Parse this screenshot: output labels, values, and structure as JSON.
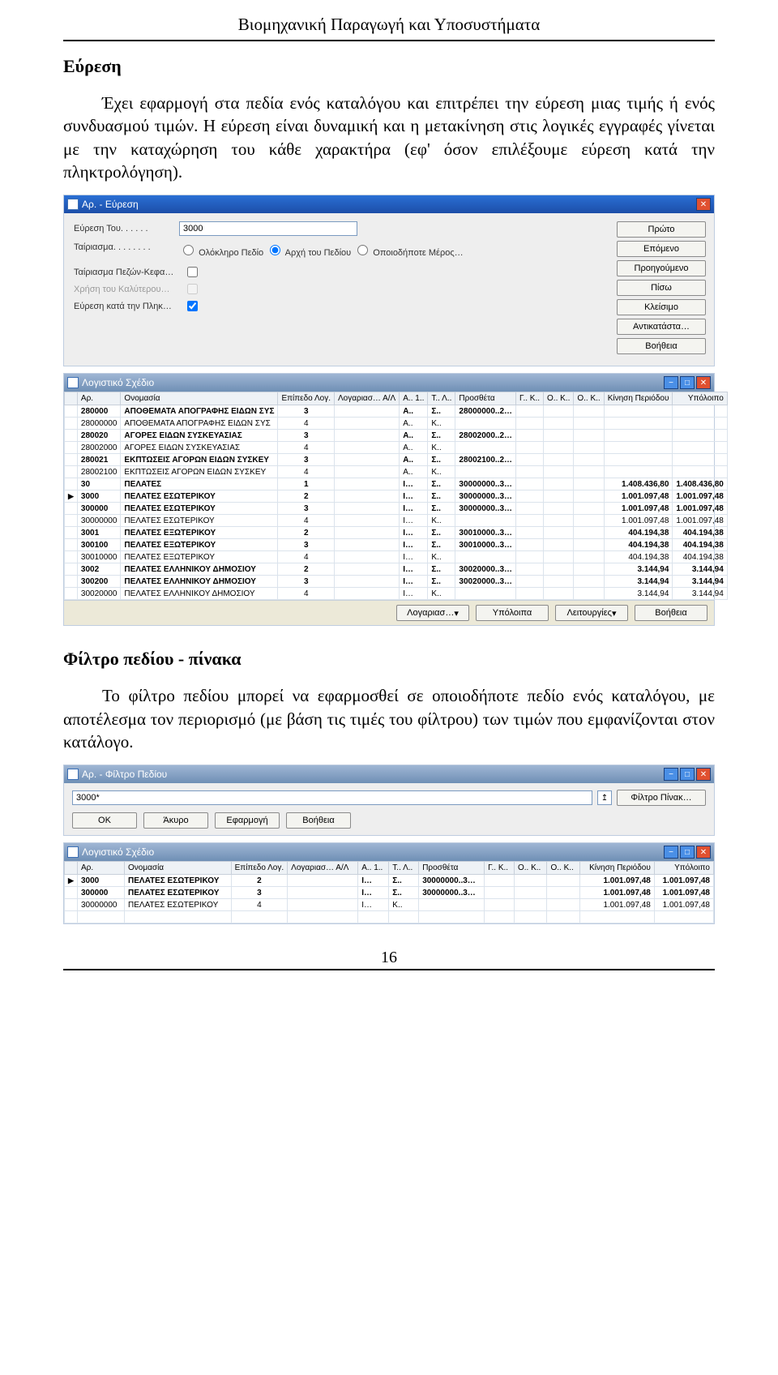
{
  "doc": {
    "running_head": "Βιομηχανική Παραγωγή και Υποσυστήματα",
    "section1_heading": "Εύρεση",
    "para1_line": "Έχει εφαρμογή στα πεδία ενός καταλόγου και επιτρέπει την εύρεση μιας τιμής ή ενός συνδυασμού τιμών. Η εύρεση είναι δυναμική και η μετακίνηση στις λογικές εγγραφές γίνεται με την καταχώρηση του κάθε χαρακτήρα (εφ' όσον επιλέξουμε εύρεση κατά την πληκτρολόγηση).",
    "section2_heading": "Φίλτρο πεδίου - πίνακα",
    "para2_line": "Το φίλτρο πεδίου μπορεί να εφαρμοσθεί σε οποιοδήποτε πεδίο ενός καταλόγου, με αποτέλεσμα τον περιορισμό (με βάση τις τιμές του φίλτρου) των τιμών που εμφανίζονται στον κατάλογο.",
    "page_number": "16"
  },
  "find_dialog": {
    "title": "Αρ. - Εύρεση",
    "field_label": "Εύρεση Του. . . . . .",
    "field_value": "3000",
    "match_label": "Ταίριασμα. . . . . . . .",
    "radio_whole": "Ολόκληρο Πεδίο",
    "radio_begin": "Αρχή του Πεδίου",
    "radio_any": "Οποιοδήποτε Μέρος…",
    "case_label": "Ταίριασμα Πεζών-Κεφα…",
    "best_label": "Χρήση του Καλύτερου…",
    "typing_label": "Εύρεση κατά την Πληκ…",
    "buttons": {
      "first": "Πρώτο",
      "next": "Επόμενο",
      "prev": "Προηγούμενο",
      "back": "Πίσω",
      "close": "Κλείσιμο",
      "replace": "Αντικατάστα…",
      "help": "Βοήθεια"
    }
  },
  "plan_window": {
    "title": "Λογιστικό Σχέδιο",
    "headers": {
      "ar": "Αρ.",
      "name": "Ονομασία",
      "level": "Επίπεδο Λογ.",
      "acc": "Λογαριασ… Α/Λ",
      "a": "Α.. 1..",
      "t": "Τ.. Λ..",
      "extra": "Προσθέτα",
      "g": "Γ.. Κ..",
      "o1": "Ο.. Κ..",
      "o2": "Ο.. Κ..",
      "kin": "Κίνηση Περιόδου",
      "ypol": "Υπόλοιπο"
    },
    "rows": [
      {
        "sel": "",
        "ar": "280000",
        "name": "ΑΠΟΘΕΜΑΤΑ ΑΠΟΓΡΑΦΗΣ ΕΙΔΩΝ ΣΥΣ",
        "lv": "3",
        "a": "Α..",
        "t": "Σ..",
        "extra": "28000000..2…",
        "kin": "",
        "ypol": "",
        "strong": true
      },
      {
        "sel": "",
        "ar": "28000000",
        "name": "ΑΠΟΘΕΜΑΤΑ ΑΠΟΓΡΑΦΗΣ ΕΙΔΩΝ ΣΥΣ",
        "lv": "4",
        "a": "Α..",
        "t": "Κ..",
        "extra": "",
        "kin": "",
        "ypol": ""
      },
      {
        "sel": "",
        "ar": "280020",
        "name": "ΑΓΟΡΕΣ ΕΙΔΩΝ ΣΥΣΚΕΥΑΣΙΑΣ",
        "lv": "3",
        "a": "Α..",
        "t": "Σ..",
        "extra": "28002000..2…",
        "kin": "",
        "ypol": "",
        "strong": true
      },
      {
        "sel": "",
        "ar": "28002000",
        "name": "ΑΓΟΡΕΣ ΕΙΔΩΝ ΣΥΣΚΕΥΑΣΙΑΣ",
        "lv": "4",
        "a": "Α..",
        "t": "Κ..",
        "extra": "",
        "kin": "",
        "ypol": ""
      },
      {
        "sel": "",
        "ar": "280021",
        "name": "ΕΚΠΤΩΣΕΙΣ ΑΓΟΡΩΝ ΕΙΔΩΝ ΣΥΣΚΕΥ",
        "lv": "3",
        "a": "Α..",
        "t": "Σ..",
        "extra": "28002100..2…",
        "kin": "",
        "ypol": "",
        "strong": true
      },
      {
        "sel": "",
        "ar": "28002100",
        "name": "ΕΚΠΤΩΣΕΙΣ ΑΓΟΡΩΝ ΕΙΔΩΝ ΣΥΣΚΕΥ",
        "lv": "4",
        "a": "Α..",
        "t": "Κ..",
        "extra": "",
        "kin": "",
        "ypol": ""
      },
      {
        "sel": "",
        "ar": "30",
        "name": "ΠΕΛΑΤΕΣ",
        "lv": "1",
        "a": "Ι…",
        "t": "Σ..",
        "extra": "30000000..3…",
        "kin": "1.408.436,80",
        "ypol": "1.408.436,80",
        "strong": true
      },
      {
        "sel": "▶",
        "ar": "3000",
        "name": "ΠΕΛΑΤΕΣ ΕΣΩΤΕΡΙΚΟΥ",
        "lv": "2",
        "a": "Ι…",
        "t": "Σ..",
        "extra": "30000000..3…",
        "kin": "1.001.097,48",
        "ypol": "1.001.097,48",
        "strong": true
      },
      {
        "sel": "",
        "ar": "300000",
        "name": "ΠΕΛΑΤΕΣ ΕΣΩΤΕΡΙΚΟΥ",
        "lv": "3",
        "a": "Ι…",
        "t": "Σ..",
        "extra": "30000000..3…",
        "kin": "1.001.097,48",
        "ypol": "1.001.097,48",
        "strong": true
      },
      {
        "sel": "",
        "ar": "30000000",
        "name": "ΠΕΛΑΤΕΣ ΕΣΩΤΕΡΙΚΟΥ",
        "lv": "4",
        "a": "Ι…",
        "t": "Κ..",
        "extra": "",
        "kin": "1.001.097,48",
        "ypol": "1.001.097,48"
      },
      {
        "sel": "",
        "ar": "3001",
        "name": "ΠΕΛΑΤΕΣ ΕΞΩΤΕΡΙΚΟΥ",
        "lv": "2",
        "a": "Ι…",
        "t": "Σ..",
        "extra": "30010000..3…",
        "kin": "404.194,38",
        "ypol": "404.194,38",
        "strong": true
      },
      {
        "sel": "",
        "ar": "300100",
        "name": "ΠΕΛΑΤΕΣ ΕΞΩΤΕΡΙΚΟΥ",
        "lv": "3",
        "a": "Ι…",
        "t": "Σ..",
        "extra": "30010000..3…",
        "kin": "404.194,38",
        "ypol": "404.194,38",
        "strong": true
      },
      {
        "sel": "",
        "ar": "30010000",
        "name": "ΠΕΛΑΤΕΣ ΕΞΩΤΕΡΙΚΟΥ",
        "lv": "4",
        "a": "Ι…",
        "t": "Κ..",
        "extra": "",
        "kin": "404.194,38",
        "ypol": "404.194,38"
      },
      {
        "sel": "",
        "ar": "3002",
        "name": "ΠΕΛΑΤΕΣ ΕΛΛΗΝΙΚΟΥ ΔΗΜΟΣΙΟΥ",
        "lv": "2",
        "a": "Ι…",
        "t": "Σ..",
        "extra": "30020000..3…",
        "kin": "3.144,94",
        "ypol": "3.144,94",
        "strong": true
      },
      {
        "sel": "",
        "ar": "300200",
        "name": "ΠΕΛΑΤΕΣ ΕΛΛΗΝΙΚΟΥ ΔΗΜΟΣΙΟΥ",
        "lv": "3",
        "a": "Ι…",
        "t": "Σ..",
        "extra": "30020000..3…",
        "kin": "3.144,94",
        "ypol": "3.144,94",
        "strong": true
      },
      {
        "sel": "",
        "ar": "30020000",
        "name": "ΠΕΛΑΤΕΣ ΕΛΛΗΝΙΚΟΥ ΔΗΜΟΣΙΟΥ",
        "lv": "4",
        "a": "Ι…",
        "t": "Κ..",
        "extra": "",
        "kin": "3.144,94",
        "ypol": "3.144,94"
      }
    ],
    "bottom_buttons": {
      "account": "Λογαριασ…",
      "balance": "Υπόλοιπα",
      "functions": "Λειτουργίες",
      "help": "Βοήθεια"
    }
  },
  "filter_dialog": {
    "title": "Αρ. - Φίλτρο Πεδίου",
    "value": "3000*",
    "filter_table_btn": "Φίλτρο Πίνακ…",
    "ok": "OK",
    "cancel": "Άκυρο",
    "apply": "Εφαρμογή",
    "help": "Βοήθεια"
  },
  "plan_window2": {
    "title": "Λογιστικό Σχέδιο",
    "rows": [
      {
        "sel": "▶",
        "ar": "3000",
        "name": "ΠΕΛΑΤΕΣ ΕΣΩΤΕΡΙΚΟΥ",
        "lv": "2",
        "a": "Ι…",
        "t": "Σ..",
        "extra": "30000000..3…",
        "kin": "1.001.097,48",
        "ypol": "1.001.097,48",
        "strong": true
      },
      {
        "sel": "",
        "ar": "300000",
        "name": "ΠΕΛΑΤΕΣ ΕΣΩΤΕΡΙΚΟΥ",
        "lv": "3",
        "a": "Ι…",
        "t": "Σ..",
        "extra": "30000000..3…",
        "kin": "1.001.097,48",
        "ypol": "1.001.097,48",
        "strong": true
      },
      {
        "sel": "",
        "ar": "30000000",
        "name": "ΠΕΛΑΤΕΣ ΕΣΩΤΕΡΙΚΟΥ",
        "lv": "4",
        "a": "Ι…",
        "t": "Κ..",
        "extra": "",
        "kin": "1.001.097,48",
        "ypol": "1.001.097,48"
      }
    ]
  }
}
